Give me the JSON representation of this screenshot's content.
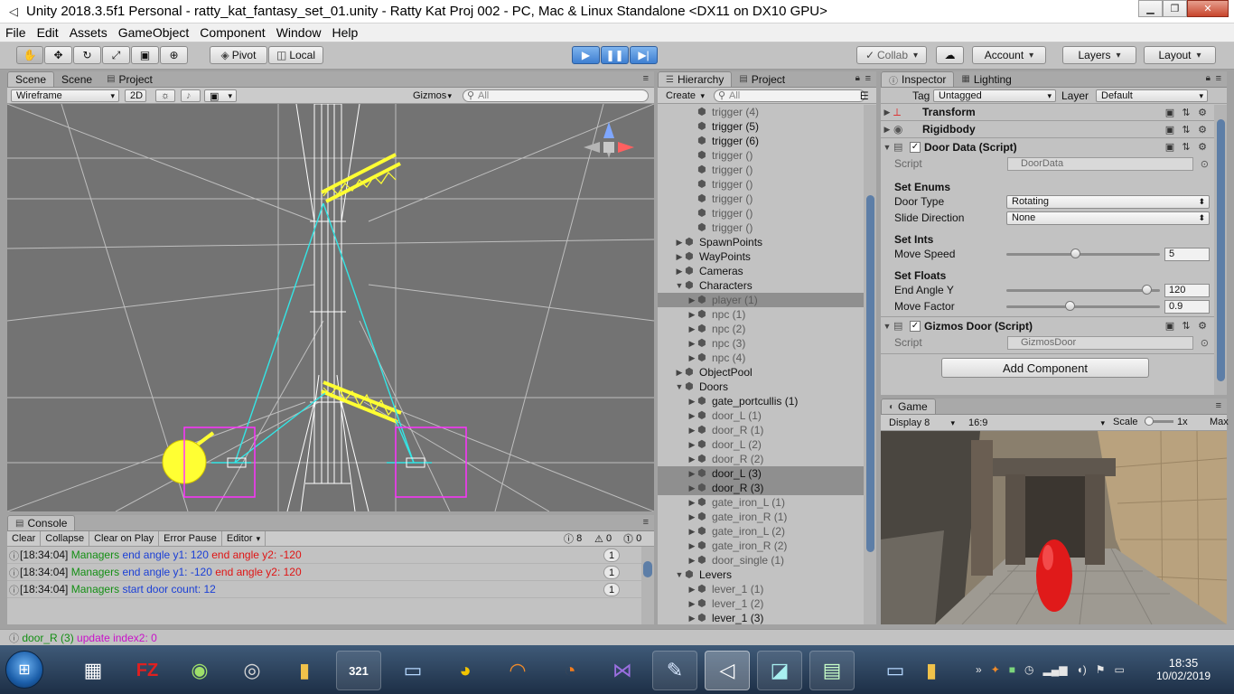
{
  "window": {
    "title": "Unity 2018.3.5f1 Personal - ratty_kat_fantasy_set_01.unity - Ratty Kat Proj 002 - PC, Mac & Linux Standalone <DX11 on DX10 GPU>"
  },
  "menu": [
    "File",
    "Edit",
    "Assets",
    "GameObject",
    "Component",
    "Window",
    "Help"
  ],
  "toolbar": {
    "pivot": "Pivot",
    "local": "Local",
    "collab": "Collab",
    "account": "Account",
    "layers": "Layers",
    "layout": "Layout"
  },
  "scene": {
    "tabs": [
      "Scene",
      "Scene",
      "Project"
    ],
    "shading": "Wireframe",
    "mode_2d": "2D",
    "gizmos": "Gizmos",
    "search_placeholder": "All"
  },
  "console": {
    "tab": "Console",
    "buttons": [
      "Clear",
      "Collapse",
      "Clear on Play",
      "Error Pause",
      "Editor"
    ],
    "counts": {
      "log": "8",
      "warn": "0",
      "error": "0"
    },
    "rows": [
      {
        "time": "[18:34:04]",
        "a": "Managers",
        "b": "end angle y1: 120",
        "c": "end angle y2: -120",
        "count": "1"
      },
      {
        "time": "[18:34:04]",
        "a": "Managers",
        "b": "end angle y1: -120",
        "c": "end angle y2: 120",
        "count": "1"
      },
      {
        "time": "[18:34:04]",
        "a": "Managers",
        "b": "start door count: 12",
        "c": "",
        "count": "1"
      }
    ]
  },
  "status": {
    "object": "door_R (3)",
    "message": "update index2: 0"
  },
  "hierarchy": {
    "tabs": [
      "Hierarchy",
      "Project"
    ],
    "create": "Create",
    "search_placeholder": "All",
    "items": [
      {
        "label": "trigger (4)",
        "indent": 2,
        "arrow": "",
        "state": "inactive"
      },
      {
        "label": "trigger (5)",
        "indent": 2,
        "arrow": "",
        "state": "normal"
      },
      {
        "label": "trigger (6)",
        "indent": 2,
        "arrow": "",
        "state": "normal"
      },
      {
        "label": "trigger ()",
        "indent": 2,
        "arrow": "",
        "state": "inactive"
      },
      {
        "label": "trigger ()",
        "indent": 2,
        "arrow": "",
        "state": "inactive"
      },
      {
        "label": "trigger ()",
        "indent": 2,
        "arrow": "",
        "state": "inactive"
      },
      {
        "label": "trigger ()",
        "indent": 2,
        "arrow": "",
        "state": "inactive"
      },
      {
        "label": "trigger ()",
        "indent": 2,
        "arrow": "",
        "state": "inactive"
      },
      {
        "label": "trigger ()",
        "indent": 2,
        "arrow": "",
        "state": "inactive"
      },
      {
        "label": "SpawnPoints",
        "indent": 1,
        "arrow": "▶",
        "state": "normal"
      },
      {
        "label": "WayPoints",
        "indent": 1,
        "arrow": "▶",
        "state": "normal"
      },
      {
        "label": "Cameras",
        "indent": 1,
        "arrow": "▶",
        "state": "normal"
      },
      {
        "label": "Characters",
        "indent": 1,
        "arrow": "▼",
        "state": "normal"
      },
      {
        "label": "player (1)",
        "indent": 2,
        "arrow": "▶",
        "state": "selected-inactive"
      },
      {
        "label": "npc (1)",
        "indent": 2,
        "arrow": "▶",
        "state": "inactive"
      },
      {
        "label": "npc (2)",
        "indent": 2,
        "arrow": "▶",
        "state": "inactive"
      },
      {
        "label": "npc (3)",
        "indent": 2,
        "arrow": "▶",
        "state": "inactive"
      },
      {
        "label": "npc (4)",
        "indent": 2,
        "arrow": "▶",
        "state": "inactive"
      },
      {
        "label": "ObjectPool",
        "indent": 1,
        "arrow": "▶",
        "state": "normal"
      },
      {
        "label": "Doors",
        "indent": 1,
        "arrow": "▼",
        "state": "normal"
      },
      {
        "label": "gate_portcullis (1)",
        "indent": 2,
        "arrow": "▶",
        "state": "normal"
      },
      {
        "label": "door_L (1)",
        "indent": 2,
        "arrow": "▶",
        "state": "inactive"
      },
      {
        "label": "door_R (1)",
        "indent": 2,
        "arrow": "▶",
        "state": "inactive"
      },
      {
        "label": "door_L (2)",
        "indent": 2,
        "arrow": "▶",
        "state": "inactive"
      },
      {
        "label": "door_R (2)",
        "indent": 2,
        "arrow": "▶",
        "state": "inactive"
      },
      {
        "label": "door_L (3)",
        "indent": 2,
        "arrow": "▶",
        "state": "selected"
      },
      {
        "label": "door_R (3)",
        "indent": 2,
        "arrow": "▶",
        "state": "selected"
      },
      {
        "label": "gate_iron_L (1)",
        "indent": 2,
        "arrow": "▶",
        "state": "inactive"
      },
      {
        "label": "gate_iron_R (1)",
        "indent": 2,
        "arrow": "▶",
        "state": "inactive"
      },
      {
        "label": "gate_iron_L (2)",
        "indent": 2,
        "arrow": "▶",
        "state": "inactive"
      },
      {
        "label": "gate_iron_R (2)",
        "indent": 2,
        "arrow": "▶",
        "state": "inactive"
      },
      {
        "label": "door_single (1)",
        "indent": 2,
        "arrow": "▶",
        "state": "inactive"
      },
      {
        "label": "Levers",
        "indent": 1,
        "arrow": "▼",
        "state": "normal"
      },
      {
        "label": "lever_1 (1)",
        "indent": 2,
        "arrow": "▶",
        "state": "inactive"
      },
      {
        "label": "lever_1 (2)",
        "indent": 2,
        "arrow": "▶",
        "state": "inactive"
      },
      {
        "label": "lever_1 (3)",
        "indent": 2,
        "arrow": "▶",
        "state": "normal"
      }
    ]
  },
  "inspector": {
    "tabs": [
      "Inspector",
      "Lighting"
    ],
    "tag_label": "Tag",
    "tag_value": "Untagged",
    "layer_label": "Layer",
    "layer_value": "Default",
    "components": {
      "transform": "Transform",
      "rigidbody": "Rigidbody",
      "door_data": "Door Data (Script)",
      "gizmos_door": "Gizmos Door (Script)"
    },
    "script_label": "Script",
    "door_script": "DoorData",
    "gizmos_script": "GizmosDoor",
    "set_enums": "Set Enums",
    "door_type_label": "Door Type",
    "door_type_value": "Rotating",
    "slide_dir_label": "Slide Direction",
    "slide_dir_value": "None",
    "set_ints": "Set Ints",
    "move_speed_label": "Move Speed",
    "move_speed_value": "5",
    "move_speed_fraction": 0.45,
    "set_floats": "Set Floats",
    "end_angle_label": "End Angle Y",
    "end_angle_value": "120",
    "end_angle_fraction": 0.92,
    "move_factor_label": "Move Factor",
    "move_factor_value": "0.9",
    "move_factor_fraction": 0.42,
    "add_component": "Add Component"
  },
  "game": {
    "tab": "Game",
    "display": "Display 8",
    "aspect": "16:9",
    "scale_label": "Scale",
    "scale_value": "1x",
    "maximize": "Max"
  },
  "taskbar": {
    "time": "18:35",
    "date": "10/02/2019",
    "fz_label": "FZ",
    "calendar_label": "321"
  }
}
